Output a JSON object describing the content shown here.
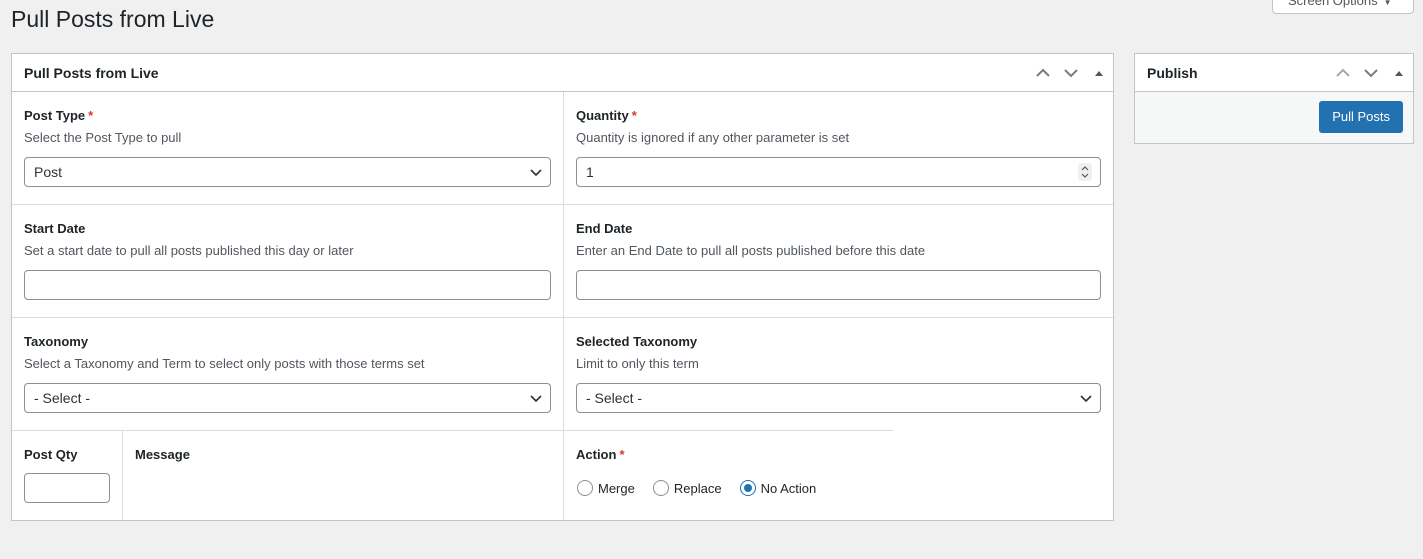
{
  "page": {
    "title": "Pull Posts from Live",
    "screen_options_label": "Screen Options",
    "screen_options_icon": "caret-down-icon"
  },
  "main_box": {
    "title": "Pull Posts from Live",
    "fields": {
      "post_type": {
        "label": "Post Type",
        "required": "*",
        "description": "Select the Post Type to pull",
        "value": "Post"
      },
      "quantity": {
        "label": "Quantity",
        "required": "*",
        "description": "Quantity is ignored if any other parameter is set",
        "value": "1"
      },
      "start_date": {
        "label": "Start Date",
        "description": "Set a start date to pull all posts published this day or later",
        "value": ""
      },
      "end_date": {
        "label": "End Date",
        "description": "Enter an End Date to pull all posts published before this date",
        "value": ""
      },
      "taxonomy": {
        "label": "Taxonomy",
        "description": "Select a Taxonomy and Term to select only posts with those terms set",
        "value": "- Select -"
      },
      "selected_taxonomy": {
        "label": "Selected Taxonomy",
        "description": "Limit to only this term",
        "value": "- Select -"
      },
      "post_qty": {
        "label": "Post Qty",
        "value": ""
      },
      "message": {
        "label": "Message"
      },
      "action": {
        "label": "Action",
        "required": "*",
        "options": [
          {
            "label": "Merge",
            "checked": false
          },
          {
            "label": "Replace",
            "checked": false
          },
          {
            "label": "No Action",
            "checked": true
          }
        ]
      }
    }
  },
  "publish_box": {
    "title": "Publish",
    "button_label": "Pull Posts"
  },
  "colors": {
    "accent": "#2271b1",
    "required": "#d63638",
    "background": "#f0f0f1"
  }
}
